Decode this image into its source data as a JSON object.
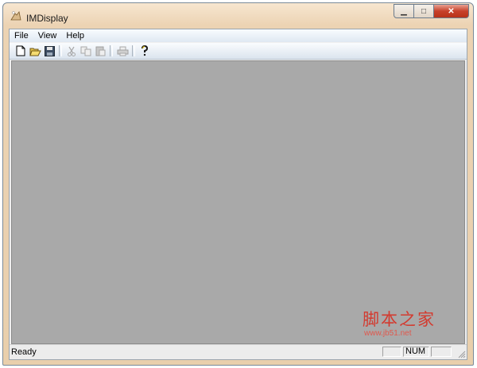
{
  "window": {
    "title": "IMDisplay",
    "min_glyph": "▁",
    "max_glyph": "□",
    "close_glyph": "✕"
  },
  "menu": {
    "items": [
      "File",
      "View",
      "Help"
    ]
  },
  "toolbar": {
    "buttons": [
      {
        "name": "new-icon",
        "enabled": true
      },
      {
        "name": "open-icon",
        "enabled": true
      },
      {
        "name": "save-icon",
        "enabled": true
      },
      {
        "name": "cut-icon",
        "enabled": false
      },
      {
        "name": "copy-icon",
        "enabled": false
      },
      {
        "name": "paste-icon",
        "enabled": false
      },
      {
        "name": "print-icon",
        "enabled": false
      },
      {
        "name": "help-icon",
        "enabled": true
      }
    ]
  },
  "colors": {
    "workspace": "#a9a9a9",
    "titlebar": "#ecd3b3",
    "watermark": "#d33a2f"
  },
  "status": {
    "text": "Ready",
    "num_indicator": "NUM"
  },
  "watermark": {
    "text": "脚本之家",
    "url": "www.jb51.net"
  }
}
